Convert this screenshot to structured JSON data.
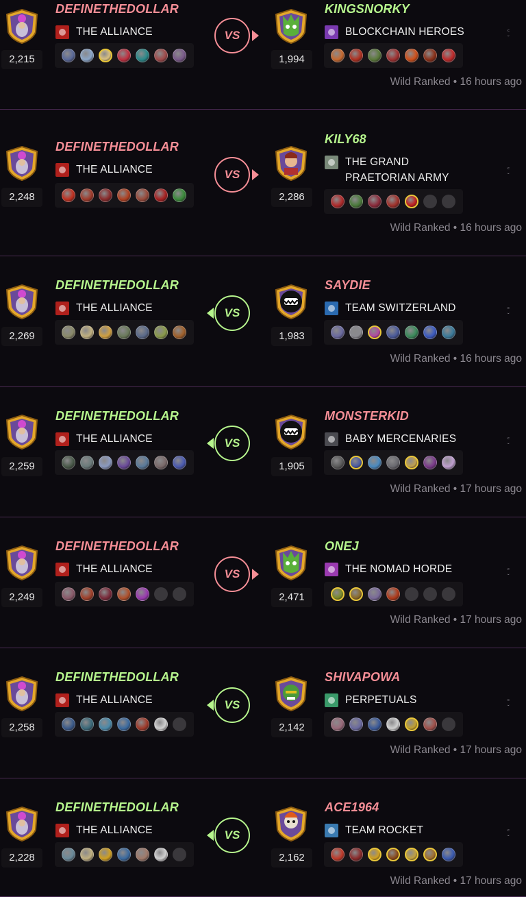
{
  "colors": {
    "winner": "#b6f58d",
    "loser": "#f58e96",
    "meta": "#8c8890"
  },
  "battles": [
    {
      "result": "loss",
      "left": {
        "name": "DEFINETHEDOLLAR",
        "guild": "THE ALLIANCE",
        "guild_color": "#b0201c",
        "rating": "2,215",
        "name_color": "#f58e96",
        "avatar": "wizard",
        "cards": [
          [
            "#5a6a9a",
            0
          ],
          [
            "#8aa6c8",
            0
          ],
          [
            "#d8c080",
            1
          ],
          [
            "#c03040",
            0
          ],
          [
            "#2a8a8a",
            0
          ],
          [
            "#a04a4a",
            0
          ],
          [
            "#7a5a8a",
            0
          ]
        ]
      },
      "right": {
        "name": "KINGSNORKY",
        "guild": "BLOCKCHAIN HEROES",
        "guild_color": "#7a3ab0",
        "rating": "1,994",
        "name_color": "#b6f58d",
        "avatar": "green",
        "cards": [
          [
            "#c86a30",
            0
          ],
          [
            "#b03020",
            0
          ],
          [
            "#5a7a3a",
            0
          ],
          [
            "#a03030",
            0
          ],
          [
            "#d0501a",
            0
          ],
          [
            "#8a3018",
            0
          ],
          [
            "#c02a2a",
            0
          ]
        ]
      },
      "meta": "Wild Ranked • 16 hours ago"
    },
    {
      "result": "loss",
      "left": {
        "name": "DEFINETHEDOLLAR",
        "guild": "THE ALLIANCE",
        "guild_color": "#b0201c",
        "rating": "2,248",
        "name_color": "#f58e96",
        "avatar": "wizard",
        "cards": [
          [
            "#c03020",
            0
          ],
          [
            "#a03a2a",
            0
          ],
          [
            "#8a2a2a",
            0
          ],
          [
            "#b04020",
            0
          ],
          [
            "#9a4a3a",
            0
          ],
          [
            "#a82020",
            0
          ],
          [
            "#3a8a3a",
            0
          ]
        ]
      },
      "right": {
        "name": "KILY68",
        "guild": "THE GRAND PRAETORIAN ARMY",
        "guild_lines": [
          "THE GRAND",
          "PRAETORIAN ARMY"
        ],
        "guild_color": "#7a8a7a",
        "rating": "2,286",
        "name_color": "#b6f58d",
        "avatar": "queen",
        "cards": [
          [
            "#b02a2a",
            0
          ],
          [
            "#4a7a3a",
            0
          ],
          [
            "#8a2a3a",
            0
          ],
          [
            "#a0302a",
            0
          ],
          [
            "#c02020",
            1
          ],
          [
            "empty",
            0
          ],
          [
            "empty",
            0
          ]
        ]
      },
      "meta": "Wild Ranked • 16 hours ago"
    },
    {
      "result": "win",
      "left": {
        "name": "DEFINETHEDOLLAR",
        "guild": "THE ALLIANCE",
        "guild_color": "#b0201c",
        "rating": "2,269",
        "name_color": "#b6f58d",
        "avatar": "wizard",
        "cards": [
          [
            "#8a8a6a",
            0
          ],
          [
            "#c0b080",
            0
          ],
          [
            "#d0a040",
            0
          ],
          [
            "#6a7a5a",
            0
          ],
          [
            "#5a6a8a",
            0
          ],
          [
            "#8a9a4a",
            0
          ],
          [
            "#a0602a",
            0
          ]
        ]
      },
      "right": {
        "name": "SAYDIE",
        "guild": "TEAM SWITZERLAND",
        "guild_color": "#2a6ab0",
        "rating": "1,983",
        "name_color": "#f58e96",
        "avatar": "monster",
        "cards": [
          [
            "#6a6aa0",
            0
          ],
          [
            "#8a8a90",
            0
          ],
          [
            "#b04aa0",
            1
          ],
          [
            "#4a5a9a",
            0
          ],
          [
            "#3a8a5a",
            0
          ],
          [
            "#3a5ac0",
            0
          ],
          [
            "#3a7a9a",
            0
          ]
        ]
      },
      "meta": "Wild Ranked • 16 hours ago"
    },
    {
      "result": "win",
      "left": {
        "name": "DEFINETHEDOLLAR",
        "guild": "THE ALLIANCE",
        "guild_color": "#b0201c",
        "rating": "2,259",
        "name_color": "#b6f58d",
        "avatar": "wizard",
        "cards": [
          [
            "#4a5a4a",
            0
          ],
          [
            "#6a7a7a",
            0
          ],
          [
            "#8a9ac0",
            0
          ],
          [
            "#6a4a9a",
            0
          ],
          [
            "#5a7a9a",
            0
          ],
          [
            "#7a6a6a",
            0
          ],
          [
            "#4a5ab0",
            0
          ]
        ]
      },
      "right": {
        "name": "MONSTERKID",
        "guild": "BABY MERCENARIES",
        "guild_color": "#4a4a50",
        "rating": "1,905",
        "name_color": "#f58e96",
        "avatar": "monster",
        "cards": [
          [
            "#5a5a5a",
            0
          ],
          [
            "#4a5aa0",
            1
          ],
          [
            "#4a8ac0",
            0
          ],
          [
            "#6a6a70",
            0
          ],
          [
            "#c0a050",
            1
          ],
          [
            "#7a3a8a",
            0
          ],
          [
            "#c0a0d0",
            0
          ]
        ]
      },
      "meta": "Wild Ranked • 17 hours ago"
    },
    {
      "result": "loss",
      "left": {
        "name": "DEFINETHEDOLLAR",
        "guild": "THE ALLIANCE",
        "guild_color": "#b0201c",
        "rating": "2,249",
        "name_color": "#f58e96",
        "avatar": "wizard",
        "cards": [
          [
            "#8a5a6a",
            0
          ],
          [
            "#a0402a",
            0
          ],
          [
            "#7a2a3a",
            0
          ],
          [
            "#b0502a",
            0
          ],
          [
            "#9a3ab0",
            0
          ],
          [
            "empty",
            0
          ],
          [
            "empty",
            0
          ]
        ]
      },
      "right": {
        "name": "ONEJ",
        "guild": "THE NOMAD HORDE",
        "guild_color": "#9a3ab0",
        "rating": "2,471",
        "name_color": "#b6f58d",
        "avatar": "green",
        "cards": [
          [
            "#7a8a2a",
            1
          ],
          [
            "#8a6a2a",
            1
          ],
          [
            "#7a6a9a",
            0
          ],
          [
            "#b03a1a",
            0
          ],
          [
            "empty",
            0
          ],
          [
            "empty",
            0
          ],
          [
            "empty",
            0
          ]
        ]
      },
      "meta": "Wild Ranked • 17 hours ago"
    },
    {
      "result": "win",
      "left": {
        "name": "DEFINETHEDOLLAR",
        "guild": "THE ALLIANCE",
        "guild_color": "#b0201c",
        "rating": "2,258",
        "name_color": "#b6f58d",
        "avatar": "wizard",
        "cards": [
          [
            "#3a5a8a",
            0
          ],
          [
            "#3a6a7a",
            0
          ],
          [
            "#4a8aaa",
            0
          ],
          [
            "#3a6aa0",
            0
          ],
          [
            "#a03a2a",
            0
          ],
          [
            "#d0d0d0",
            0
          ],
          [
            "empty",
            0
          ]
        ]
      },
      "right": {
        "name": "SHIVAPOWA",
        "guild": "PERPETUALS",
        "guild_color": "#3a9a6a",
        "rating": "2,142",
        "name_color": "#f58e96",
        "avatar": "orc",
        "cards": [
          [
            "#9a6a7a",
            0
          ],
          [
            "#6a6aa0",
            0
          ],
          [
            "#3a5a9a",
            0
          ],
          [
            "#d0d0d0",
            0
          ],
          [
            "#c0a030",
            1
          ],
          [
            "#a0504a",
            0
          ],
          [
            "empty",
            0
          ]
        ]
      },
      "meta": "Wild Ranked • 17 hours ago"
    },
    {
      "result": "win",
      "left": {
        "name": "DEFINETHEDOLLAR",
        "guild": "THE ALLIANCE",
        "guild_color": "#b0201c",
        "rating": "2,228",
        "name_color": "#b6f58d",
        "avatar": "wizard",
        "cards": [
          [
            "#6a8a9a",
            0
          ],
          [
            "#c0b080",
            0
          ],
          [
            "#d0a020",
            0
          ],
          [
            "#3a6aa0",
            0
          ],
          [
            "#a07a6a",
            0
          ],
          [
            "#d0d0d0",
            0
          ],
          [
            "empty",
            0
          ]
        ]
      },
      "right": {
        "name": "ACE1964",
        "guild": "TEAM ROCKET",
        "guild_color": "#3a7ab0",
        "rating": "2,162",
        "name_color": "#f58e96",
        "avatar": "rocket",
        "cards": [
          [
            "#c03a2a",
            0
          ],
          [
            "#8a2a2a",
            0
          ],
          [
            "#d0a020",
            1
          ],
          [
            "#8a4a1a",
            1
          ],
          [
            "#c0a040",
            1
          ],
          [
            "#a07030",
            1
          ],
          [
            "#3a5ab0",
            0
          ]
        ]
      },
      "meta": "Wild Ranked • 17 hours ago"
    }
  ]
}
